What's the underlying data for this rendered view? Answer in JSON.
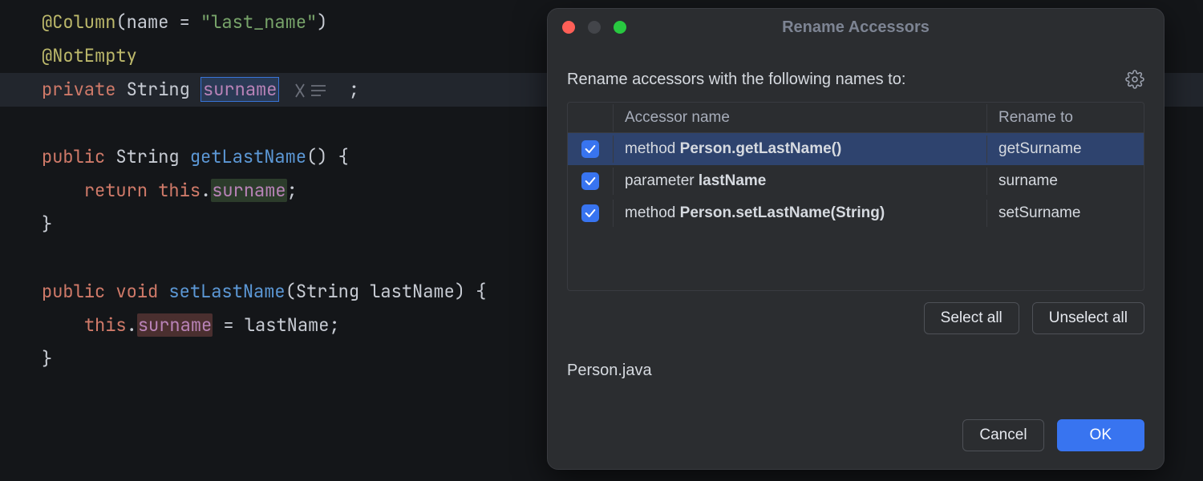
{
  "editor": {
    "lines": {
      "l1_ann": "@Column",
      "l1_key": "name",
      "l1_val": "\"last_name\"",
      "l2_ann": "@NotEmpty",
      "l3_kw": "private",
      "l3_type": "String",
      "l3_field": "surname",
      "l3_end": ";",
      "l5_kw": "public",
      "l5_type": "String",
      "l5_method": "getLastName",
      "l5_sig": "() {",
      "l6_kw": "return",
      "l6_this": "this",
      "l6_field": "surname",
      "l6_end": ";",
      "l7": "}",
      "l9_kw": "public",
      "l9_ret": "void",
      "l9_method": "setLastName",
      "l9_ptype": "String",
      "l9_pname": "lastName",
      "l9_end": ") {",
      "l10_this": "this",
      "l10_field": "surname",
      "l10_eq": " = ",
      "l10_param": "lastName",
      "l10_end": ";",
      "l11": "}"
    }
  },
  "dialog": {
    "title": "Rename Accessors",
    "instruction": "Rename accessors with the following names to:",
    "col_name": "Accessor name",
    "col_rename": "Rename to",
    "rows": [
      {
        "checked": true,
        "kind": "method ",
        "sig": "Person.getLastName()",
        "rename": "getSurname",
        "selected": true
      },
      {
        "checked": true,
        "kind": "parameter ",
        "sig": "lastName",
        "rename": "surname",
        "selected": false
      },
      {
        "checked": true,
        "kind": "method ",
        "sig": "Person.setLastName(String)",
        "rename": "setSurname",
        "selected": false
      }
    ],
    "select_all": "Select all",
    "unselect_all": "Unselect all",
    "file": "Person.java",
    "cancel": "Cancel",
    "ok": "OK"
  }
}
